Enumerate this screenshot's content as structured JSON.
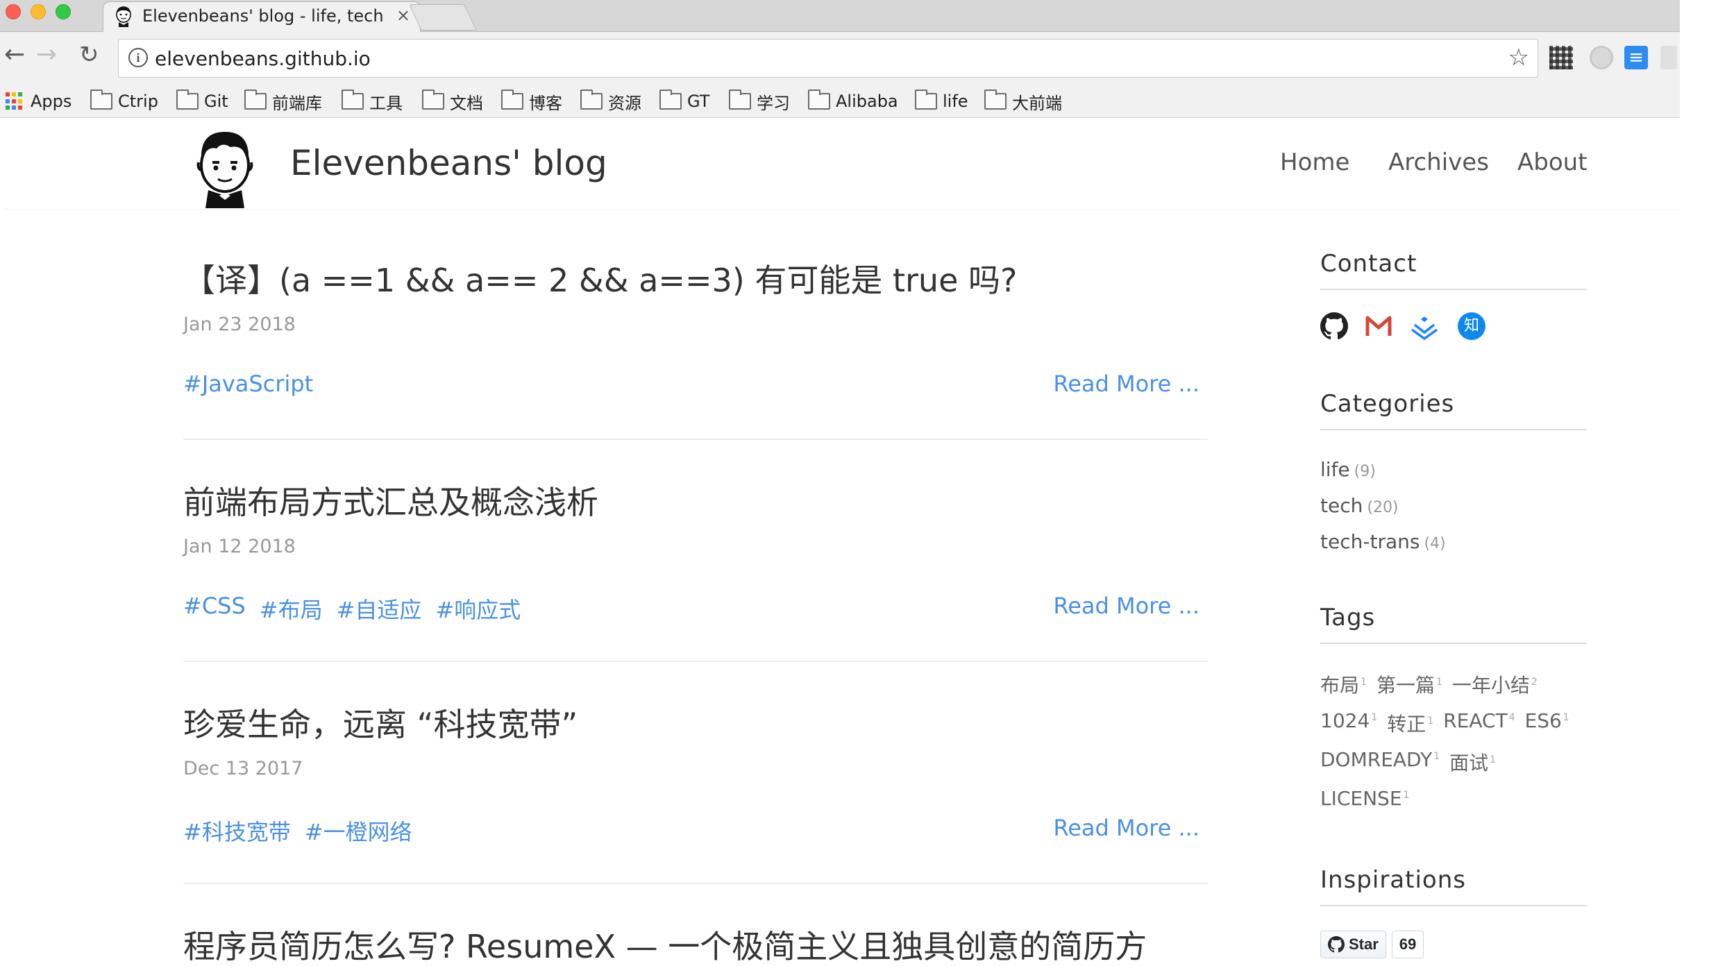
{
  "browser": {
    "tab_title": "Elevenbeans' blog - life, tech",
    "tab_close": "×",
    "url": "elevenbeans.github.io",
    "bookmarks": [
      "Apps",
      "Ctrip",
      "Git",
      "前端库",
      "工具",
      "文档",
      "博客",
      "资源",
      "GT",
      "学习",
      "Alibaba",
      "life",
      "大前端"
    ]
  },
  "site": {
    "title": "Elevenbeans' blog",
    "nav": [
      "Home",
      "Archives",
      "About"
    ]
  },
  "posts": [
    {
      "title": "【译】(a ==1 && a== 2 && a==3) 有可能是 true 吗?",
      "date": "Jan 23 2018",
      "tags": [
        "#JavaScript"
      ],
      "read_more": "Read More ..."
    },
    {
      "title": "前端布局方式汇总及概念浅析",
      "date": "Jan 12 2018",
      "tags": [
        "#CSS",
        "#布局",
        "#自适应",
        "#响应式"
      ],
      "read_more": "Read More ..."
    },
    {
      "title": "珍爱生命，远离 “科技宽带”",
      "date": "Dec 13 2017",
      "tags": [
        "#科技宽带",
        "#一橙网络"
      ],
      "read_more": "Read More ..."
    },
    {
      "title": "程序员简历怎么写? ResumeX — 一个极简主义且独具创意的简历方"
    }
  ],
  "sidebar": {
    "contact": {
      "title": "Contact",
      "zhihu_label": "知",
      "icons": [
        "github-icon",
        "gmail-icon",
        "juejin-icon",
        "zhihu-icon"
      ]
    },
    "categories": {
      "title": "Categories",
      "items": [
        {
          "name": "life",
          "count": "(9)"
        },
        {
          "name": "tech",
          "count": "(20)"
        },
        {
          "name": "tech-trans",
          "count": "(4)"
        }
      ]
    },
    "tags": {
      "title": "Tags",
      "rows": [
        [
          {
            "name": "布局",
            "count": "1"
          },
          {
            "name": "第一篇",
            "count": "1"
          },
          {
            "name": "一年小结",
            "count": "2"
          }
        ],
        [
          {
            "name": "1024",
            "count": "1"
          },
          {
            "name": "转正",
            "count": "1"
          },
          {
            "name": "REACT",
            "count": "4"
          },
          {
            "name": "ES6",
            "count": "1"
          }
        ],
        [
          {
            "name": "DOMREADY",
            "count": "1"
          },
          {
            "name": "面试",
            "count": "1"
          }
        ],
        [
          {
            "name": "LICENSE",
            "count": "1"
          }
        ]
      ]
    },
    "inspirations": {
      "title": "Inspirations",
      "star_label": "Star",
      "star_count": "69"
    }
  },
  "colors": {
    "link": "#4a90e2",
    "gmail": "#d44638",
    "zhihu": "#0f88eb",
    "juejin": "#1e80ff"
  }
}
